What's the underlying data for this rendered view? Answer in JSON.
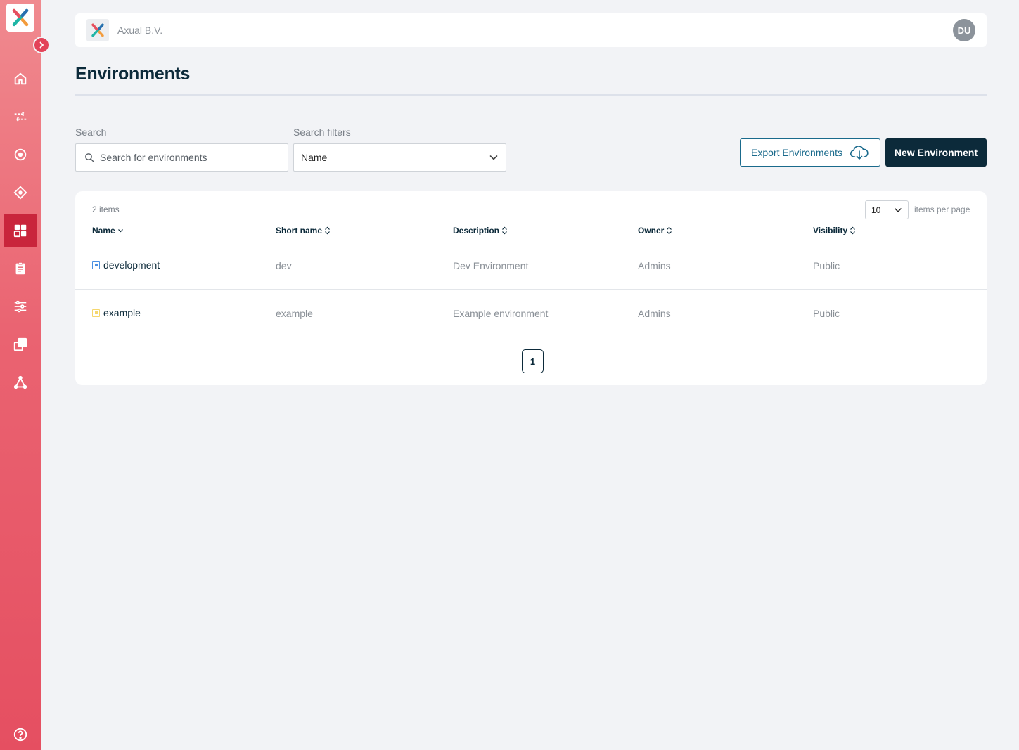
{
  "organization": {
    "name": "Axual B.V.",
    "avatar_initials": "DU"
  },
  "sidebar": {
    "items": [
      {
        "id": "home",
        "icon": "home-icon"
      },
      {
        "id": "streams",
        "icon": "streams-icon"
      },
      {
        "id": "applications",
        "icon": "target-icon"
      },
      {
        "id": "schemas",
        "icon": "diamond-icon"
      },
      {
        "id": "environments",
        "icon": "dashboard-icon",
        "active": true
      },
      {
        "id": "logs",
        "icon": "clipboard-icon"
      },
      {
        "id": "settings",
        "icon": "sliders-icon"
      },
      {
        "id": "instances",
        "icon": "copy-icon"
      },
      {
        "id": "network",
        "icon": "network-icon"
      },
      {
        "id": "help",
        "icon": "help-icon"
      }
    ]
  },
  "page": {
    "title": "Environments"
  },
  "search": {
    "label": "Search",
    "placeholder": "Search for environments",
    "filters_label": "Search filters",
    "filter_value": "Name"
  },
  "actions": {
    "export_label": "Export Environments",
    "new_label": "New Environment"
  },
  "table": {
    "item_count": "2 items",
    "per_page_value": "10",
    "per_page_label": "items per page",
    "columns": {
      "name": "Name",
      "short_name": "Short name",
      "description": "Description",
      "owner": "Owner",
      "visibility": "Visibility"
    },
    "rows": [
      {
        "name": "development",
        "short_name": "dev",
        "description": "Dev Environment",
        "owner": "Admins",
        "visibility": "Public",
        "color": "#4a90e2"
      },
      {
        "name": "example",
        "short_name": "example",
        "description": "Example environment",
        "owner": "Admins",
        "visibility": "Public",
        "color": "#f5d76e"
      }
    ],
    "current_page": "1"
  },
  "colors": {
    "accent": "#e54f61",
    "brand_dark": "#0c2a3a",
    "link": "#1a6a8c"
  }
}
